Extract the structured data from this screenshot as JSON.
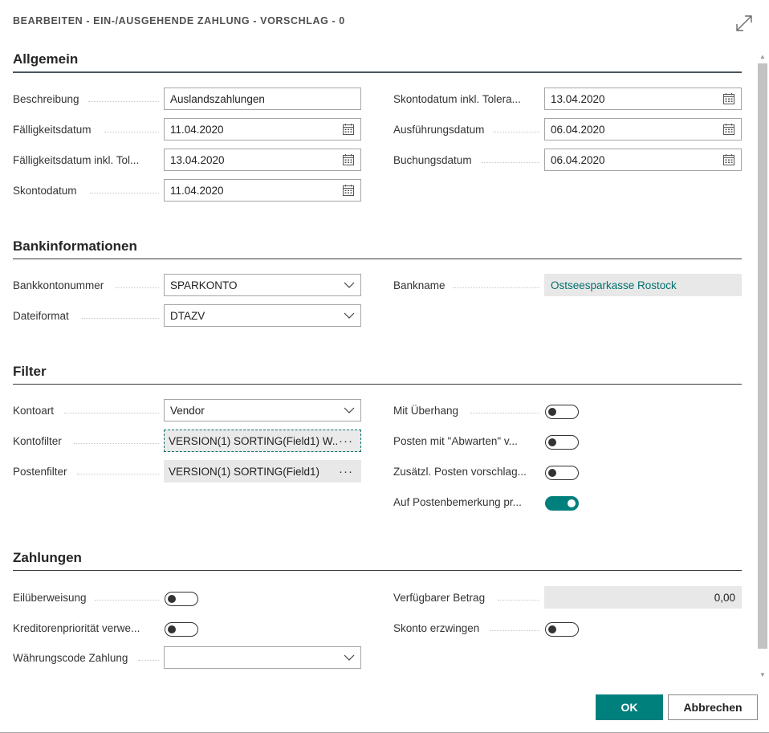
{
  "dialog": {
    "title": "BEARBEITEN - EIN-/AUSGEHENDE ZAHLUNG - VORSCHLAG - 0",
    "ok_label": "OK",
    "cancel_label": "Abbrechen",
    "accent_color": "#00807d"
  },
  "allgemein": {
    "title": "Allgemein",
    "beschreibung": {
      "label": "Beschreibung",
      "value": "Auslandszahlungen"
    },
    "faelligkeitsdatum": {
      "label": "Fälligkeitsdatum",
      "value": "11.04.2020"
    },
    "faelligkeitsdatum_tol": {
      "label": "Fälligkeitsdatum inkl. Tol...",
      "value": "13.04.2020"
    },
    "skontodatum": {
      "label": "Skontodatum",
      "value": "11.04.2020"
    },
    "skontodatum_tol": {
      "label": "Skontodatum inkl. Tolera...",
      "value": "13.04.2020"
    },
    "ausfuehrungsdatum": {
      "label": "Ausführungsdatum",
      "value": "06.04.2020"
    },
    "buchungsdatum": {
      "label": "Buchungsdatum",
      "value": "06.04.2020"
    }
  },
  "bankinfo": {
    "title": "Bankinformationen",
    "bankkontonummer": {
      "label": "Bankkontonummer",
      "value": "SPARKONTO"
    },
    "dateiformat": {
      "label": "Dateiformat",
      "value": "DTAZV"
    },
    "bankname": {
      "label": "Bankname",
      "value": "Ostseesparkasse Rostock"
    }
  },
  "filter": {
    "title": "Filter",
    "kontoart": {
      "label": "Kontoart",
      "value": "Vendor"
    },
    "kontofilter": {
      "label": "Kontofilter",
      "value": "VERSION(1) SORTING(Field1) W..."
    },
    "postenfilter": {
      "label": "Postenfilter",
      "value": "VERSION(1) SORTING(Field1)"
    },
    "mit_ueberhang": {
      "label": "Mit Überhang",
      "on": false
    },
    "posten_abwarten": {
      "label": "Posten mit \"Abwarten\" v...",
      "on": false
    },
    "zusaetzl_posten": {
      "label": "Zusätzl. Posten vorschlag...",
      "on": false
    },
    "postenbemerkung": {
      "label": "Auf Postenbemerkung pr...",
      "on": true
    }
  },
  "zahlungen": {
    "title": "Zahlungen",
    "eilueberweisung": {
      "label": "Eilüberweisung",
      "on": false
    },
    "kreditorenprioritaet": {
      "label": "Kreditorenpriorität verwe...",
      "on": false
    },
    "waehrungscode": {
      "label": "Währungscode Zahlung",
      "value": ""
    },
    "verfuegbarer_betrag": {
      "label": "Verfügbarer Betrag",
      "value": "0,00"
    },
    "skonto_erzwingen": {
      "label": "Skonto erzwingen",
      "on": false
    }
  }
}
